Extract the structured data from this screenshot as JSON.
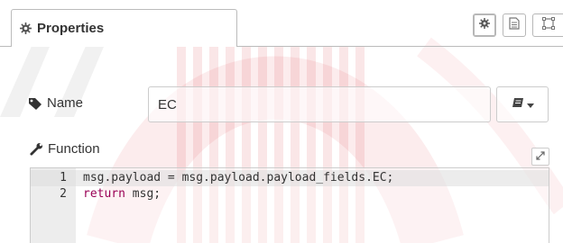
{
  "tabs": {
    "properties_label": "Properties"
  },
  "toolbar": [
    {
      "icon": "gear-icon",
      "active": true
    },
    {
      "icon": "document-icon",
      "active": false
    },
    {
      "icon": "frame-icon",
      "active": false
    }
  ],
  "form": {
    "name_label": "Name",
    "name_value": "EC",
    "function_label": "Function"
  },
  "editor": {
    "lines": [
      {
        "number": "1",
        "code": "msg.payload = msg.payload.payload_fields.EC;"
      },
      {
        "number": "2",
        "keyword": "return",
        "rest": " msg;"
      }
    ]
  },
  "colors": {
    "watermark": "#e0464e",
    "keyword": "#990055",
    "border": "#cccccc"
  }
}
